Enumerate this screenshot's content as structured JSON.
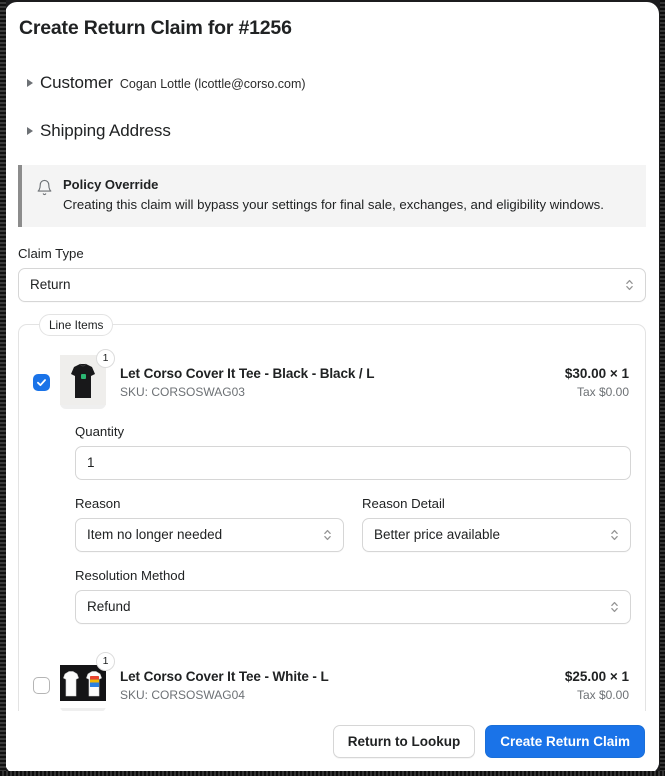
{
  "modal": {
    "title": "Create Return Claim for #1256"
  },
  "sections": [
    {
      "label": "Customer",
      "value": "Cogan Lottle (lcottle@corso.com)",
      "expanded": false,
      "icon": "triangle-right-icon"
    },
    {
      "label": "Shipping Address",
      "value": "",
      "expanded": false,
      "icon": "triangle-right-icon"
    }
  ],
  "banner": {
    "icon": "bell-icon",
    "title": "Policy Override",
    "text": "Creating this claim will bypass your settings for final sale, exchanges, and eligibility windows.",
    "background_color": "#f4f4f4",
    "accent_color": "#8c8c8c"
  },
  "claim_type": {
    "label": "Claim Type",
    "value": "Return",
    "icon": "chevron-updown-icon"
  },
  "line_items_fieldset": {
    "legend": "Line Items"
  },
  "line_items": [
    {
      "selected": true,
      "badge_quantity": "1",
      "title": "Let Corso Cover It Tee - Black - Black / L",
      "sku": "SKU: CORSOSWAG03",
      "price": "$30.00 × 1",
      "tax": "Tax $0.00",
      "thumbnail": "black-tee-thumbnail",
      "form": {
        "quantity_label": "Quantity",
        "quantity_value": "1",
        "reason_label": "Reason",
        "reason_value": "Item no longer needed",
        "reason_detail_label": "Reason Detail",
        "reason_detail_value": "Better price available",
        "resolution_label": "Resolution Method",
        "resolution_value": "Refund"
      }
    },
    {
      "selected": false,
      "badge_quantity": "1",
      "title": "Let Corso Cover It Tee - White - L",
      "sku": "SKU: CORSOSWAG04",
      "price": "$25.00 × 1",
      "tax": "Tax $0.00",
      "thumbnail": "white-tee-thumbnail"
    }
  ],
  "footer": {
    "secondary_label": "Return to Lookup",
    "primary_label": "Create Return Claim",
    "primary_color": "#1a73e8"
  }
}
